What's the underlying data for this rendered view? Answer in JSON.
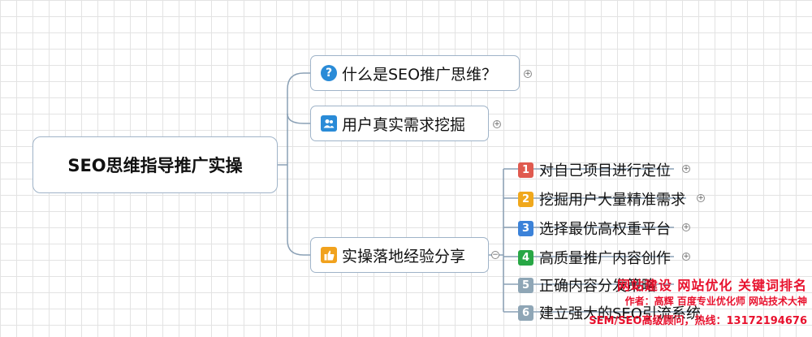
{
  "root": {
    "label": "SEO思维指导推广实操"
  },
  "branches": [
    {
      "label": "什么是SEO推广思维？",
      "icon": "question-icon"
    },
    {
      "label": "用户真实需求挖掘",
      "icon": "users-icon"
    },
    {
      "label": "实操落地经验分享",
      "icon": "thumbs-up-icon"
    }
  ],
  "leaves": [
    {
      "num": "1",
      "label": "对自己项目进行定位",
      "color": "#e05a4f"
    },
    {
      "num": "2",
      "label": "挖掘用户大量精准需求",
      "color": "#f0a81c"
    },
    {
      "num": "3",
      "label": "选择最优高权重平台",
      "color": "#3b82d9"
    },
    {
      "num": "4",
      "label": "高质量推广内容创作",
      "color": "#28a745"
    },
    {
      "num": "5",
      "label": "正确内容分发策略",
      "color": "#8fa6b6"
    },
    {
      "num": "6",
      "label": "建立强大的SEO引流系统",
      "color": "#8fa6b6"
    }
  ],
  "watermark": {
    "line1": "网站建设  网站优化  关键词排名",
    "line2": "作者：高辉   百度专业优化师   网站技术大神",
    "line3": "SEM/SEO高级顾问，热线：13172194676"
  }
}
